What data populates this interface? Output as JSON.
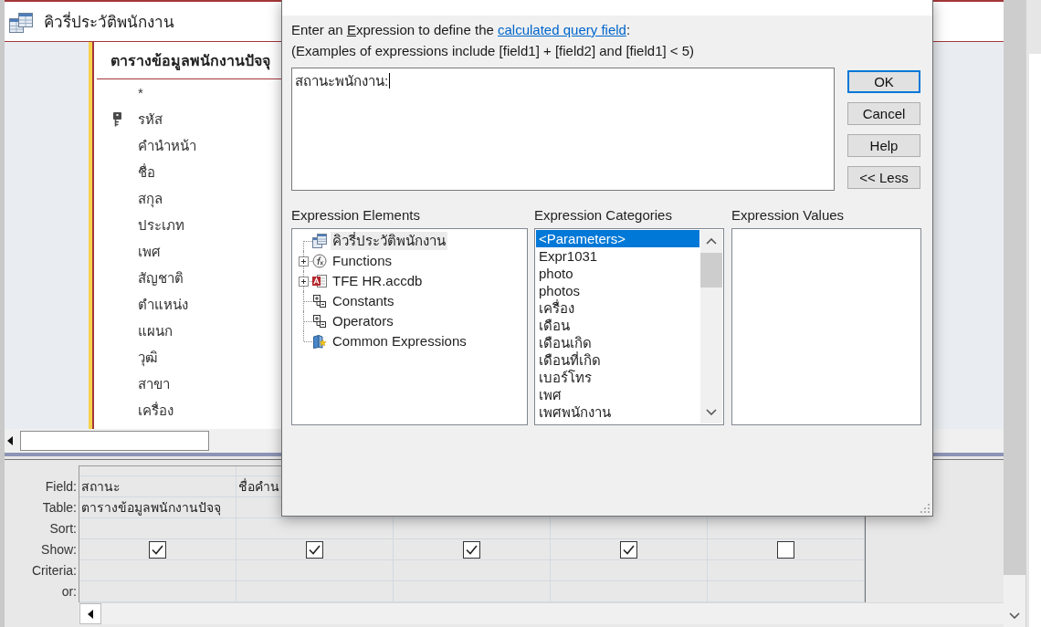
{
  "window": {
    "title": "คิวรี่ประวัติพนักงาน"
  },
  "table_pane": {
    "field_list": {
      "title": "ตารางข้อมูลพนักงานปัจจุ",
      "fields": [
        {
          "name": "*",
          "primary_key": false
        },
        {
          "name": "รหัส",
          "primary_key": true
        },
        {
          "name": "คำนำหน้า",
          "primary_key": false
        },
        {
          "name": "ชื่อ",
          "primary_key": false
        },
        {
          "name": "สกุล",
          "primary_key": false
        },
        {
          "name": "ประเภท",
          "primary_key": false
        },
        {
          "name": "เพศ",
          "primary_key": false
        },
        {
          "name": "สัญชาติ",
          "primary_key": false
        },
        {
          "name": "ตำแหน่ง",
          "primary_key": false
        },
        {
          "name": "แผนก",
          "primary_key": false
        },
        {
          "name": "วุฒิ",
          "primary_key": false
        },
        {
          "name": "สาขา",
          "primary_key": false
        },
        {
          "name": "เครื่อง",
          "primary_key": false
        }
      ]
    }
  },
  "query_grid": {
    "rows": [
      {
        "label": "Field:",
        "kind": "field"
      },
      {
        "label": "Table:",
        "kind": "table"
      },
      {
        "label": "Sort:",
        "kind": "sort"
      },
      {
        "label": "Show:",
        "kind": "show"
      },
      {
        "label": "Criteria:",
        "kind": "criteria"
      },
      {
        "label": "or:",
        "kind": "or"
      }
    ],
    "columns": [
      {
        "field": "สถานะ",
        "table": "ตารางข้อมูลพนักงานปัจจุ",
        "show_checked": true
      },
      {
        "field": "ชื่อคำน",
        "show_checked": true
      },
      {
        "show_checked": true
      },
      {
        "show_checked": true
      },
      {
        "show_checked": false
      }
    ]
  },
  "dialog": {
    "prompt": {
      "text_before": "Enter an ",
      "access_key": "E",
      "text_middle": "xpression to define the ",
      "link": "calculated query field",
      "text_after": ":"
    },
    "examples": "(Examples of expressions include [field1] + [field2] and [field1] < 5)",
    "expression": {
      "value": "สถานะพนักงาน:"
    },
    "buttons": [
      {
        "label": "OK",
        "default": true
      },
      {
        "label": "Cancel",
        "default": false
      },
      {
        "label": "Help",
        "default": false
      },
      {
        "label": "<< Less",
        "default": false
      }
    ],
    "elements": {
      "label": "Expression Elements",
      "items": [
        {
          "label": "คิวรี่ประวัติพนักงาน",
          "kind": "query",
          "collapsed": false,
          "selected": true
        },
        {
          "label": "Functions",
          "kind": "functions",
          "collapsed": true,
          "selected": false
        },
        {
          "label": "TFE HR.accdb",
          "kind": "database",
          "collapsed": true,
          "selected": false
        },
        {
          "label": "Constants",
          "kind": "group",
          "collapsed": false,
          "selected": false
        },
        {
          "label": "Operators",
          "kind": "group",
          "collapsed": false,
          "selected": false
        },
        {
          "label": "Common Expressions",
          "kind": "common",
          "collapsed": false,
          "selected": false
        }
      ]
    },
    "categories": {
      "label": "Expression Categories",
      "items": [
        {
          "label": "<Parameters>",
          "selected": true
        },
        {
          "label": "Expr1031",
          "selected": false
        },
        {
          "label": "photo",
          "selected": false
        },
        {
          "label": "photos",
          "selected": false
        },
        {
          "label": "เครื่อง",
          "selected": false
        },
        {
          "label": "เดือน",
          "selected": false
        },
        {
          "label": "เดือนเกิด",
          "selected": false
        },
        {
          "label": "เดือนที่เกิด",
          "selected": false
        },
        {
          "label": "เบอร์โทร",
          "selected": false
        },
        {
          "label": "เพศ",
          "selected": false
        },
        {
          "label": "เพศพนักงาน",
          "selected": false
        }
      ]
    },
    "values": {
      "label": "Expression Values"
    }
  }
}
